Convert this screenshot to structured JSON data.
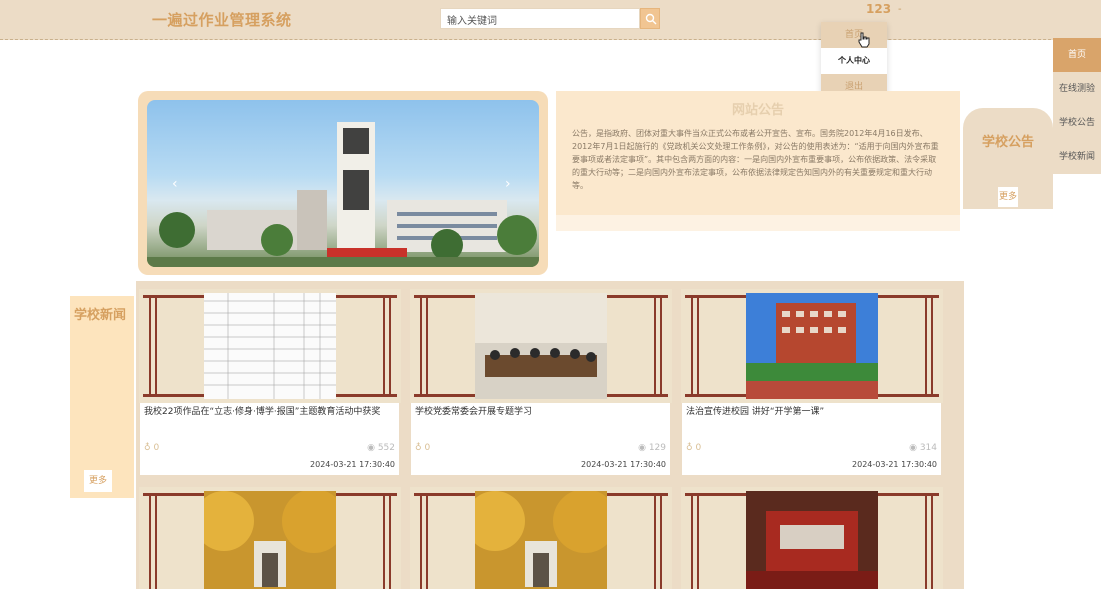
{
  "header": {
    "logo": "一遍过作业管理系统",
    "search_placeholder": "输入关键词",
    "user": "123",
    "user_sep": "-"
  },
  "dropdown": {
    "top": "首页",
    "items": [
      "个人中心",
      "退出"
    ]
  },
  "rnav": {
    "items": [
      "首页",
      "在线测验",
      "学校公告",
      "学校新闻"
    ]
  },
  "banner": {
    "arrow_left": "‹",
    "arrow_right": "›"
  },
  "notice": {
    "title": "网站公告",
    "body": "公告，是指政府、团体对重大事件当众正式公布或者公开宣告、宣布。国务院2012年4月16日发布、2012年7月1日起施行的《党政机关公文处理工作条例》，对公告的使用表述为：“适用于向国内外宣布重要事项或者法定事项”。其中包含两方面的内容：一是向国内外宣布重要事项，公布依据政策、法令采取的重大行动等；二是向国内外宣布法定事项，公布依据法律规定告知国内外的有关重要规定和重大行动等。"
  },
  "school_notice": {
    "title": "学校公告",
    "more": "更多"
  },
  "news": {
    "label": "学校新闻",
    "more": "更多",
    "cards": [
      {
        "title": "我校22项作品在“立志·修身·博学·报国”主题教育活动中获奖",
        "likes": "0",
        "views": "552",
        "date": "2024-03-21 17:30:40"
      },
      {
        "title": "学校党委常委会开展专题学习",
        "likes": "0",
        "views": "129",
        "date": "2024-03-21 17:30:40"
      },
      {
        "title": "法治宣传进校园 讲好“开学第一课”",
        "likes": "0",
        "views": "314",
        "date": "2024-03-21 17:30:40"
      }
    ]
  },
  "colors": {
    "accent": "#d6a060",
    "header_bg": "#ecdcc6",
    "active_nav": "#d9a46a"
  }
}
